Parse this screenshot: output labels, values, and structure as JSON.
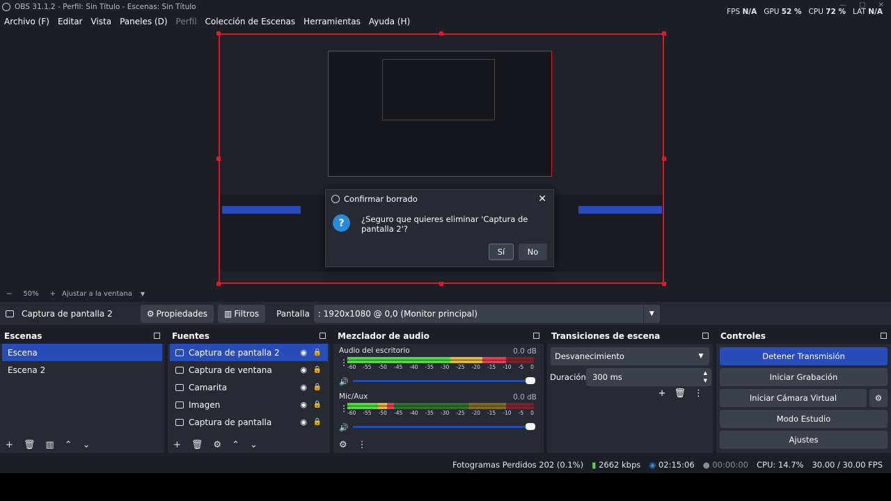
{
  "app": {
    "title": "OBS 31.1.2 - Perfil: Sin Título - Escenas: Sin Título"
  },
  "menu": [
    "Archivo (F)",
    "Editar",
    "Vista",
    "Paneles (D)",
    "Perfil",
    "Colección de Escenas",
    "Herramientas",
    "Ayuda (H)"
  ],
  "stats": {
    "fps_label": "FPS",
    "fps_value": "N/A",
    "gpu_label": "GPU",
    "gpu_value": "52 %",
    "cpu_label": "CPU",
    "cpu_value": "72 %",
    "lat_label": "LAT",
    "lat_value": "N/A"
  },
  "zoom": {
    "minus": "−",
    "level": "50%",
    "plus": "+",
    "fit_label": "Ajustar a la ventana"
  },
  "sourcebar": {
    "source_name": "Captura de pantalla 2",
    "properties_label": "Propiedades",
    "filters_label": "Filtros",
    "display_label": "Pantalla",
    "display_value": ": 1920x1080 @ 0,0 (Monitor principal)"
  },
  "scenes": {
    "title": "Escenas",
    "items": [
      "Escena",
      "Escena 2"
    ]
  },
  "sources": {
    "title": "Fuentes",
    "items": [
      "Captura de pantalla 2",
      "Captura de ventana",
      "Camarita",
      "Imagen",
      "Captura de pantalla"
    ]
  },
  "mixer": {
    "title": "Mezclador de audio",
    "tracks": [
      {
        "name": "Audio del escritorio",
        "db": "0.0 dB",
        "level": 0.85
      },
      {
        "name": "Mic/Aux",
        "db": "0.0 dB",
        "level": 0.25
      }
    ],
    "scale": [
      "-60",
      "-55",
      "-50",
      "-45",
      "-40",
      "-35",
      "-30",
      "-25",
      "-20",
      "-15",
      "-10",
      "-5",
      "0"
    ]
  },
  "transitions": {
    "title": "Transiciones de escena",
    "selected": "Desvanecimiento",
    "duration_label": "Duración",
    "duration_value": "300 ms"
  },
  "controls": {
    "title": "Controles",
    "stop_stream": "Detener Transmisión",
    "start_recording": "Iniciar Grabación",
    "virtual_cam": "Iniciar Cámara Virtual",
    "studio_mode": "Modo Estudio",
    "settings": "Ajustes"
  },
  "status": {
    "dropped": "Fotogramas Perdidos 202 (0.1%)",
    "bitrate": "2662 kbps",
    "stream_time": "02:15:06",
    "rec_time": "00:00:00",
    "cpu": "CPU: 14.7%",
    "fps": "30.00 / 30.00 FPS"
  },
  "dialog": {
    "title": "Confirmar borrado",
    "message": "¿Seguro que quieres eliminar 'Captura de pantalla 2'?",
    "yes": "Sí",
    "no": "No"
  },
  "colors": {
    "accent": "#284cb8",
    "selection_border": "#e0162c",
    "panel": "#272a33",
    "background": "#1d1f26"
  }
}
